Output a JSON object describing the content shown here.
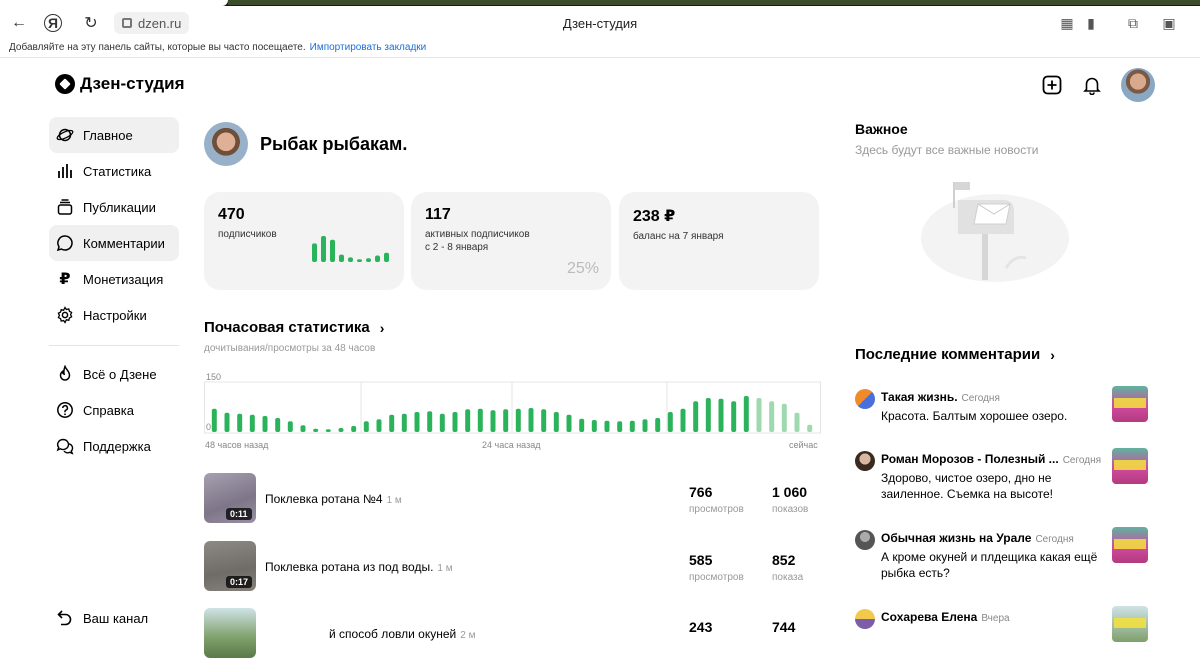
{
  "browser": {
    "address": "dzen.ru",
    "page_title": "Дзен-студия",
    "bookmarks_text": "Добавляйте на эту панель сайты, которые вы часто посещаете.",
    "bookmarks_link": "Импортировать закладки"
  },
  "header": {
    "logo_text": "Дзен-студия"
  },
  "sidebar": {
    "items": [
      {
        "label": "Главное",
        "icon": "planet-icon"
      },
      {
        "label": "Статистика",
        "icon": "bar-chart-icon"
      },
      {
        "label": "Публикации",
        "icon": "stack-icon"
      },
      {
        "label": "Комментарии",
        "icon": "comment-icon"
      },
      {
        "label": "Монетизация",
        "icon": "ruble-icon"
      },
      {
        "label": "Настройки",
        "icon": "gear-icon"
      }
    ],
    "secondary": [
      {
        "label": "Всё о Дзене",
        "icon": "flame-icon"
      },
      {
        "label": "Справка",
        "icon": "help-icon"
      },
      {
        "label": "Поддержка",
        "icon": "chat-icon"
      }
    ],
    "bottom_label": "Ваш канал"
  },
  "channel": {
    "name": "Рыбак рыбакам."
  },
  "cards": [
    {
      "value": "470",
      "label": "подписчиков"
    },
    {
      "value": "117",
      "label": "активных подписчиков",
      "label2": "с 2 - 8 января",
      "percent": "25%"
    },
    {
      "value": "238 ₽",
      "label": "баланс на 7 января"
    }
  ],
  "hourly": {
    "title": "Почасовая статистика",
    "subtitle": "дочитывания/просмотры за 48 часов",
    "ytop": "150",
    "ybottom": "0",
    "x_left": "48 часов назад",
    "x_mid": "24 часа назад",
    "x_right": "сейчас"
  },
  "chart_data": {
    "type": "bar",
    "title": "Почасовая статистика",
    "ylim": [
      0,
      150
    ],
    "values": [
      70,
      58,
      55,
      52,
      48,
      42,
      32,
      20,
      10,
      8,
      12,
      18,
      32,
      38,
      52,
      55,
      60,
      62,
      55,
      60,
      68,
      70,
      65,
      68,
      70,
      72,
      68,
      60,
      52,
      40,
      36,
      34,
      32,
      34,
      38,
      42,
      60,
      70,
      92,
      102,
      100,
      92,
      108,
      102,
      92,
      85,
      58,
      22
    ],
    "highlight_from": 43
  },
  "mini_chart_values": [
    20,
    28,
    24,
    8,
    5,
    3,
    4,
    7,
    10
  ],
  "publications": [
    {
      "title": "Поклевка ротана №4",
      "age": "1 м",
      "duration": "0:11",
      "views": "766",
      "views_label": "просмотров",
      "shows": "1 060",
      "shows_label": "показов"
    },
    {
      "title": "Поклевка ротана из под воды.",
      "age": "1 м",
      "duration": "0:17",
      "views": "585",
      "views_label": "просмотров",
      "shows": "852",
      "shows_label": "показа"
    },
    {
      "title": "й способ ловли окуней",
      "age": "2 м",
      "duration": "",
      "views": "243",
      "views_label": "",
      "shows": "744",
      "shows_label": ""
    }
  ],
  "important": {
    "title": "Важное",
    "subtitle": "Здесь будут все важные новости"
  },
  "comments_section": {
    "title": "Последние комментарии",
    "items": [
      {
        "author": "Такая жизнь.",
        "when": "Сегодня",
        "text": "Красота. Балтым хорошее озеро.",
        "avatar_color": "#e8553a"
      },
      {
        "author": "Роман Морозов - Полезный ...",
        "when": "Сегодня",
        "text": "Здорово, чистое озеро, дно не заиленное. Съемка на высоте!",
        "avatar_color": "#6b5040"
      },
      {
        "author": "Обычная жизнь на Урале",
        "when": "Сегодня",
        "text": "А кроме окуней и плдещика какая ещё рыбка есть?",
        "avatar_color": "#6c6c6c"
      },
      {
        "author": "Сохарева Елена",
        "when": "Вчера",
        "text": "",
        "avatar_color": "#7b5ea7"
      }
    ]
  }
}
